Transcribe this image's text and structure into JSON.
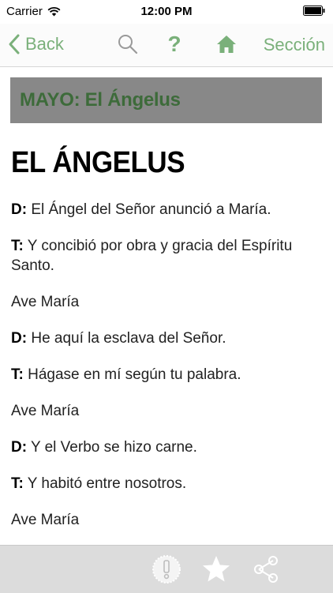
{
  "status_bar": {
    "carrier": "Carrier",
    "time": "12:00 PM",
    "wifi_icon": "wifi-icon",
    "battery_icon": "battery-icon"
  },
  "nav": {
    "back_label": "Back",
    "help_label": "?",
    "section_label": "Sección",
    "icons": [
      "chevron-left-icon",
      "search-icon",
      "help-icon",
      "home-icon"
    ]
  },
  "content": {
    "section_banner": "MAYO: El Ángelus",
    "title": "EL ÁNGELUS",
    "lines": [
      {
        "speaker": "D:",
        "text": " El Ángel del Señor anunció a María."
      },
      {
        "speaker": "T:",
        "text": " Y concibió por obra y gracia del Espíritu Santo."
      },
      {
        "speaker": "",
        "text": "Ave María"
      },
      {
        "speaker": "D:",
        "text": " He aquí la esclava del Señor."
      },
      {
        "speaker": "T:",
        "text": " Hágase en mí según tu palabra."
      },
      {
        "speaker": "",
        "text": "Ave María"
      },
      {
        "speaker": "D:",
        "text": " Y el Verbo se hizo carne."
      },
      {
        "speaker": "T:",
        "text": " Y habitó entre nosotros."
      },
      {
        "speaker": "",
        "text": "Ave María"
      }
    ]
  },
  "toolbar": {
    "icons": [
      "alert-badge-icon",
      "star-icon",
      "share-icon"
    ]
  },
  "colors": {
    "accent": "#7ab07a",
    "banner_bg": "#888888",
    "banner_text": "#3d6b3a",
    "toolbar_bg": "#dcdcdc"
  }
}
